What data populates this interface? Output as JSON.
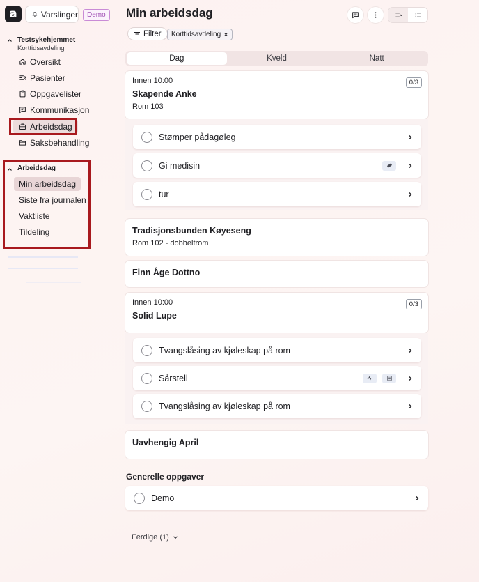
{
  "app": {
    "logo_letter": "a",
    "notifications_label": "Varslinger",
    "demo_badge": "Demo"
  },
  "sidebar": {
    "org": {
      "name": "Testsykehjemmet",
      "unit": "Korttidsavdeling"
    },
    "items": [
      {
        "label": "Oversikt",
        "icon": "home-icon"
      },
      {
        "label": "Pasienter",
        "icon": "patients-icon"
      },
      {
        "label": "Oppgavelister",
        "icon": "clipboard-icon"
      },
      {
        "label": "Kommunikasjon",
        "icon": "message-icon"
      },
      {
        "label": "Arbeidsdag",
        "icon": "briefcase-icon",
        "selected": true
      },
      {
        "label": "Saksbehandling",
        "icon": "folder-icon"
      }
    ],
    "section": {
      "title": "Arbeidsdag",
      "items": [
        {
          "label": "Min arbeidsdag",
          "selected": true
        },
        {
          "label": "Siste fra journalen"
        },
        {
          "label": "Vaktliste"
        },
        {
          "label": "Tildeling"
        }
      ]
    }
  },
  "main": {
    "title": "Min arbeidsdag",
    "filter_label": "Filter",
    "filter_chip": "Korttidsavdeling",
    "tabs": [
      {
        "label": "Dag",
        "active": true
      },
      {
        "label": "Kveld"
      },
      {
        "label": "Natt"
      }
    ],
    "patients": [
      {
        "time": "Innen 10:00",
        "name": "Skapende Anke",
        "room": "Rom 103",
        "count": "0/3",
        "tasks": [
          {
            "label": "Stømper pådagøleg"
          },
          {
            "label": "Gi medisin",
            "badges": [
              "pill-icon"
            ]
          },
          {
            "label": "tur"
          }
        ]
      },
      {
        "name": "Tradisjonsbunden Køyeseng",
        "room": "Rom 102 - dobbeltrom"
      },
      {
        "name": "Finn Åge Dottno"
      },
      {
        "time": "Innen 10:00",
        "name": "Solid Lupe",
        "count": "0/3",
        "tasks": [
          {
            "label": "Tvangslåsing av kjøleskap på rom"
          },
          {
            "label": "Sårstell",
            "badges": [
              "vitals-icon",
              "clipboard-icon"
            ]
          },
          {
            "label": "Tvangslåsing av kjøleskap på rom"
          }
        ]
      },
      {
        "name": "Uavhengig April"
      }
    ],
    "general": {
      "title": "Generelle oppgaver",
      "tasks": [
        {
          "label": "Demo"
        }
      ]
    },
    "done_label": "Ferdige (1)"
  },
  "colors": {
    "highlight_border": "#a8191e",
    "demo_accent": "#a14fb4",
    "selected_bg": "#e8d5d6"
  }
}
